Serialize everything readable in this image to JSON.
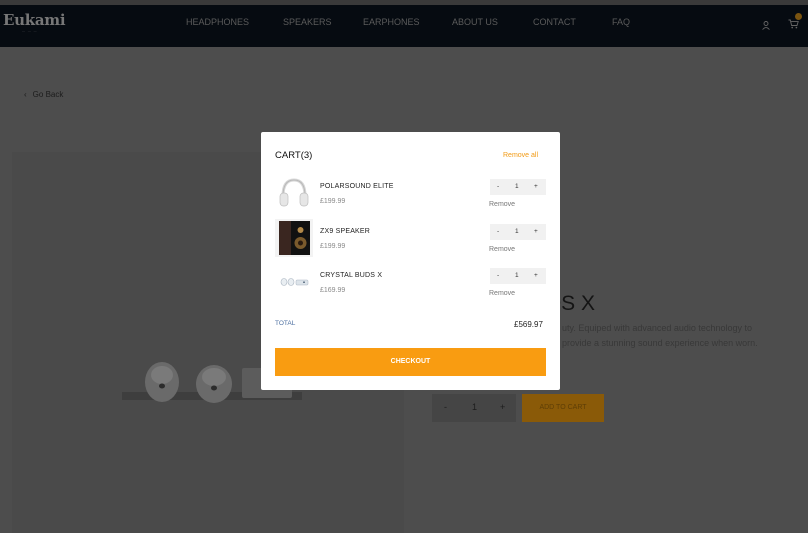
{
  "brand": {
    "logo": "Eukami"
  },
  "nav": {
    "items": [
      "HEADPHONES",
      "SPEAKERS",
      "EARPHONES",
      "ABOUT US",
      "CONTACT",
      "FAQ"
    ]
  },
  "icons": {
    "user": "user-icon",
    "cart": "cart-icon",
    "back": "chevron-left-icon"
  },
  "page": {
    "go_back": "Go Back",
    "product_title_visible": "DS X",
    "description_lines": [
      "uty. Equiped with advanced audio technology to",
      "provide a stunning sound experience when worn."
    ],
    "quantity": {
      "minus": "-",
      "value": "1",
      "plus": "+"
    },
    "add_to_cart": "ADD TO CART"
  },
  "cart": {
    "title": "CART(3)",
    "remove_all": "Remove all",
    "items": [
      {
        "name": "POLARSOUND ELITE",
        "price": "£199.99",
        "qty": "1",
        "minus": "-",
        "plus": "+",
        "remove": "Remove",
        "thumb": "white-headphones"
      },
      {
        "name": "ZX9 SPEAKER",
        "price": "£199.99",
        "qty": "1",
        "minus": "-",
        "plus": "+",
        "remove": "Remove",
        "thumb": "wooden-speaker"
      },
      {
        "name": "CRYSTAL BUDS X",
        "price": "£169.99",
        "qty": "1",
        "minus": "-",
        "plus": "+",
        "remove": "Remove",
        "thumb": "white-earbuds"
      }
    ],
    "total_label": "TOTAL",
    "total_value": "£569.97",
    "checkout": "CHECKOUT"
  },
  "colors": {
    "accent": "#f99c11",
    "header_bg": "#060b11",
    "overlay": "#4d4d4d"
  }
}
